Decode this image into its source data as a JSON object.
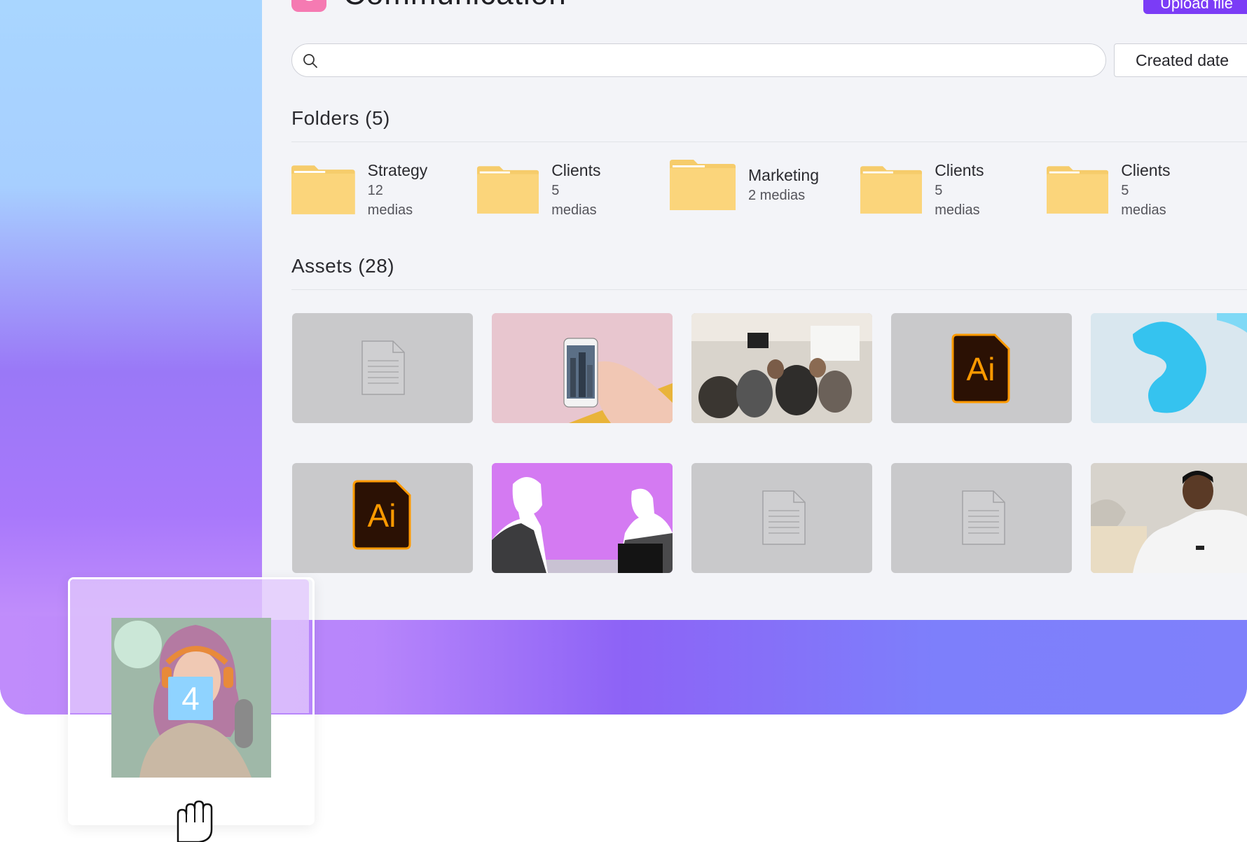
{
  "header": {
    "badge_letter": "C",
    "title": "Communication",
    "upload_label": "Upload file"
  },
  "search": {
    "placeholder": "",
    "value": ""
  },
  "sort": {
    "label": "Created date"
  },
  "folders_section": {
    "title": "Folders (5)",
    "items": [
      {
        "name": "Strategy",
        "count": "12 medias"
      },
      {
        "name": "Clients",
        "count": "5 medias"
      },
      {
        "name": "Marketing",
        "count": "2 medias"
      },
      {
        "name": "Clients",
        "count": "5 medias"
      },
      {
        "name": "Clients",
        "count": "5 medias"
      }
    ]
  },
  "assets_section": {
    "title": "Assets (28)",
    "tiles": [
      {
        "kind": "document-placeholder"
      },
      {
        "kind": "photo-phone-hand"
      },
      {
        "kind": "photo-meeting-room"
      },
      {
        "kind": "illustrator-file",
        "label": "Ai"
      },
      {
        "kind": "abstract-blue"
      },
      {
        "kind": "illustrator-file",
        "label": "Ai"
      },
      {
        "kind": "photo-business-silhouettes"
      },
      {
        "kind": "document-placeholder"
      },
      {
        "kind": "document-placeholder"
      },
      {
        "kind": "photo-man-white-hoodie"
      }
    ]
  },
  "drag": {
    "count": "4"
  },
  "colors": {
    "accent": "#7b3cf6",
    "badge": "#f57ab2",
    "folder": "#fbd57b",
    "ai_bg": "#2b1104",
    "ai_fg": "#ff9a00"
  }
}
